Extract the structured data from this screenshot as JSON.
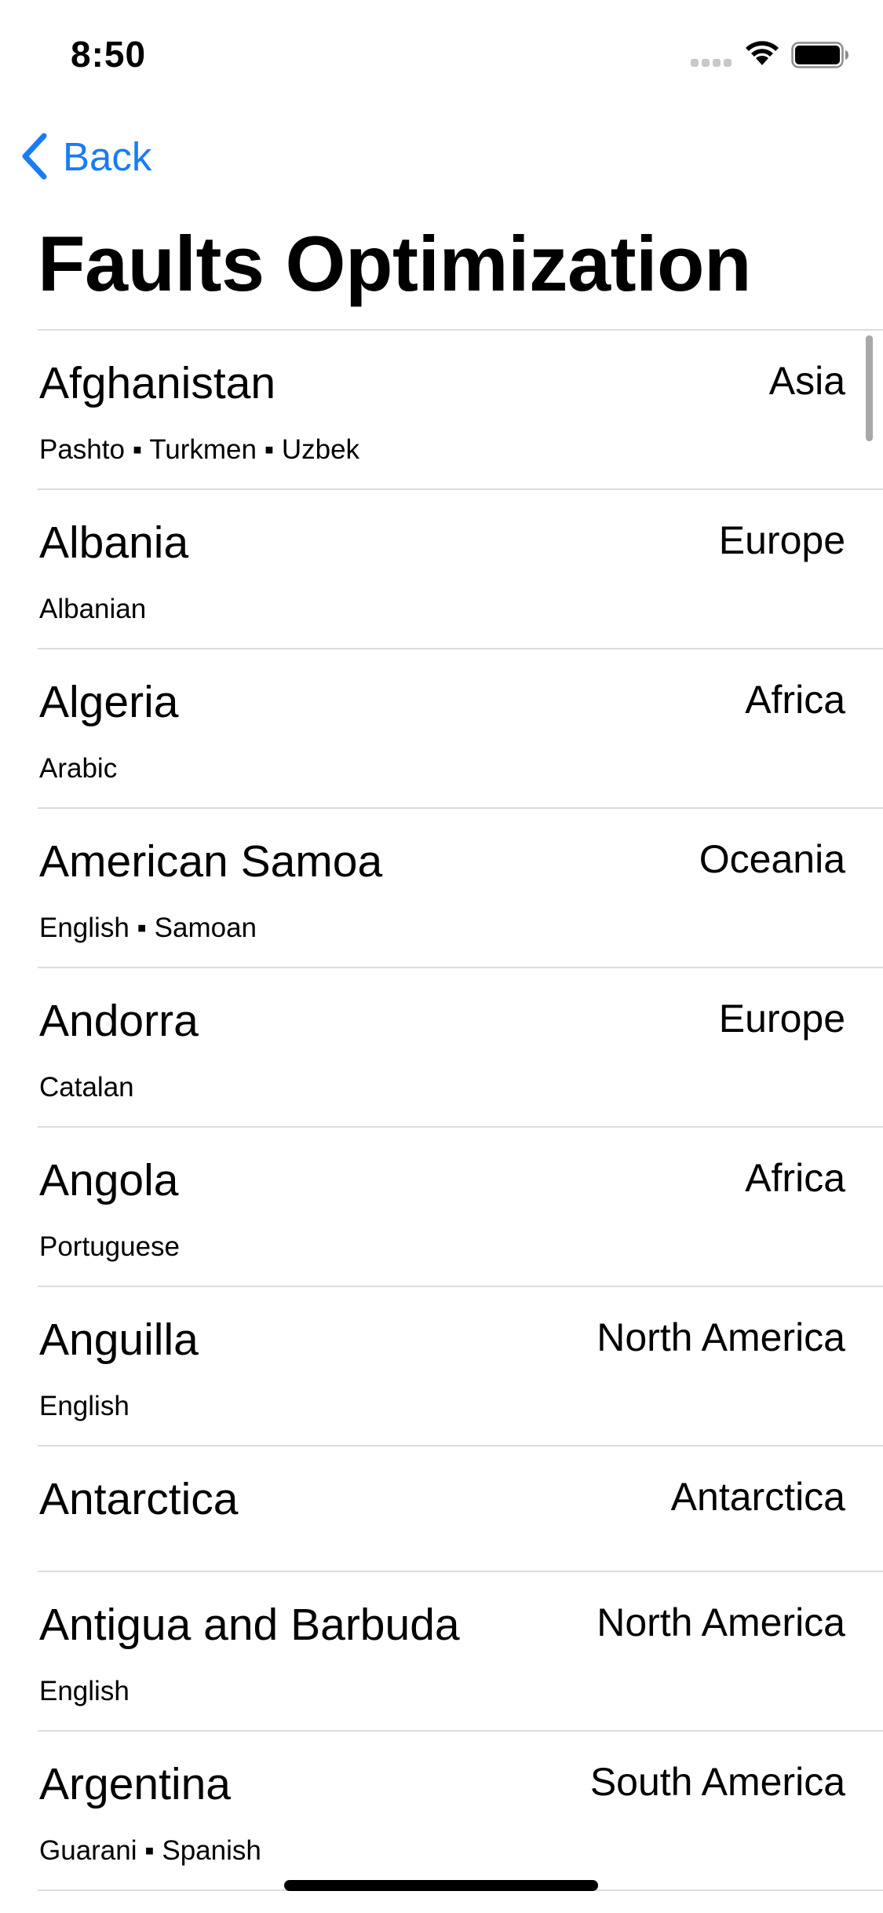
{
  "status_bar": {
    "time": "8:50"
  },
  "nav": {
    "back_label": "Back"
  },
  "title": "Faults Optimization",
  "countries": [
    {
      "name": "Afghanistan",
      "region": "Asia",
      "languages": "Pashto ▪ Turkmen ▪ Uzbek"
    },
    {
      "name": "Albania",
      "region": "Europe",
      "languages": "Albanian"
    },
    {
      "name": "Algeria",
      "region": "Africa",
      "languages": "Arabic"
    },
    {
      "name": "American Samoa",
      "region": "Oceania",
      "languages": "English ▪ Samoan"
    },
    {
      "name": "Andorra",
      "region": "Europe",
      "languages": "Catalan"
    },
    {
      "name": "Angola",
      "region": "Africa",
      "languages": "Portuguese"
    },
    {
      "name": "Anguilla",
      "region": "North America",
      "languages": "English"
    },
    {
      "name": "Antarctica",
      "region": "Antarctica",
      "languages": ""
    },
    {
      "name": "Antigua and Barbuda",
      "region": "North America",
      "languages": "English"
    },
    {
      "name": "Argentina",
      "region": "South America",
      "languages": "Guarani ▪ Spanish"
    }
  ],
  "colors": {
    "accent": "#1a7cf5",
    "separator": "#dcdcdf",
    "background": "#ffffff"
  },
  "icons": {
    "back": "chevron-left-icon",
    "wifi": "wifi-icon",
    "battery": "battery-icon",
    "signal": "cellular-signal-icon"
  }
}
